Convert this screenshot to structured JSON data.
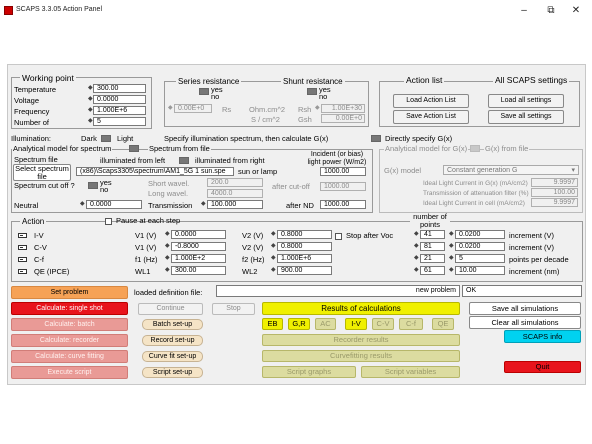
{
  "window": {
    "title": "SCAPS 3.3.05 Action Panel",
    "min": "–",
    "max": "⧉",
    "close": "✕"
  },
  "working_point": {
    "heading": "Working point",
    "rows": [
      {
        "label": "Temperature",
        "value": "300.00"
      },
      {
        "label": "Voltage",
        "value": "0.0000"
      },
      {
        "label": "Frequency",
        "value": "1.000E+6"
      },
      {
        "label": "Number of",
        "value": "5"
      }
    ]
  },
  "series_resistance": {
    "heading": "Series resistance",
    "yes": "yes",
    "no": "no",
    "value": "0.00E+0",
    "rs_label": "Rs",
    "unit1": "Ohm.cm^2",
    "unit2": "S / cm^2"
  },
  "shunt_resistance": {
    "heading": "Shunt resistance",
    "yes": "yes",
    "no": "no",
    "rsh_label": "Rsh",
    "rsh_value": "1.00E+30",
    "gsh_label": "Gsh",
    "gsh_value": "0.00E+0"
  },
  "action_list": {
    "heading": "Action list",
    "load": "Load Action List",
    "save": "Save Action List"
  },
  "all_settings": {
    "heading": "All SCAPS settings",
    "load": "Load all settings",
    "save": "Save all settings"
  },
  "illumination": {
    "label": "Illumination:",
    "dark": "Dark",
    "light": "Light",
    "spec_text": "Specify illumination spectrum, then calculate G(x)",
    "direct_text": "Directly specify G(x)"
  },
  "spectrum": {
    "analytical_label": "Analytical model for spectrum",
    "from_file_label": "Spectrum from file",
    "file_heading": "Spectrum file",
    "select_button": "Select spectrum file",
    "illum_left": "illuminated from left",
    "illum_right": "illuminated from right",
    "incident_label": "Incident (or bias) light power (W/m2)",
    "file_path": "(x86)\\Scaps3305\\spectrum\\AM1_5G 1 sun.spe",
    "sun_or_lamp_label": "sun or lamp",
    "sun_or_lamp_value": "1000.00",
    "cutoff_label": "Spectrum cut off ?",
    "cutoff_yes": "yes",
    "cutoff_no": "no",
    "short_wavel_label": "Short wavel.",
    "short_wavel_value": "200.0",
    "after_cutoff_label": "after cut-off",
    "after_cutoff_value": "1000.00",
    "long_wavel_label": "Long wavel.",
    "long_wavel_value": "4000.0",
    "neutral_label": "Neutral",
    "neutral_value": "0.0000",
    "transmission_label": "Transmission",
    "transmission_value": "100.000",
    "after_nd_label": "after ND",
    "after_nd_value": "1000.00"
  },
  "generation": {
    "analytical_label": "Analytical model for G(x)",
    "from_file_label": "G(x) from file",
    "model_label": "G(x) model",
    "model_value": "Constant generation G",
    "rows": [
      {
        "label": "Ideal Light Current in G(x) (mA/cm2)",
        "value": "9.9997"
      },
      {
        "label": "Transmission of attenuation filter (%)",
        "value": "100.00"
      },
      {
        "label": "Ideal Light Current in cell (mA/cm2)",
        "value": "9.9997"
      }
    ]
  },
  "action": {
    "heading": "Action",
    "pause_label": "Pause at each step",
    "points_heading": "number of points",
    "stop_after_voc": "Stop after Voc",
    "rows": [
      {
        "name": "I-V",
        "p1": "V1 (V)",
        "v1": "0.0000",
        "p2": "V2 (V)",
        "v2": "0.8000",
        "n": "41",
        "inc": "0.0200",
        "unit": "increment (V)"
      },
      {
        "name": "C-V",
        "p1": "V1 (V)",
        "v1": "-0.8000",
        "p2": "V2 (V)",
        "v2": "0.8000",
        "n": "81",
        "inc": "0.0200",
        "unit": "increment (V)"
      },
      {
        "name": "C-f",
        "p1": "f1 (Hz)",
        "v1": "1.000E+2",
        "p2": "f2 (Hz)",
        "v2": "1.000E+6",
        "n": "21",
        "inc": "5",
        "unit": "points per decade"
      },
      {
        "name": "QE (IPCE)",
        "p1": "WL1",
        "v1": "300.00",
        "p2": "WL2",
        "v2": "900.00",
        "n": "61",
        "inc": "10.00",
        "unit": "increment (nm)"
      }
    ]
  },
  "bottom": {
    "set_problem": "Set problem",
    "loaded_label": "loaded definition file:",
    "new_problem": "new problem",
    "ok": "OK",
    "calc_single": "Calculate: single shot",
    "continue": "Continue",
    "stop": "Stop",
    "results_heading": "Results of calculations",
    "save_all_sims": "Save all simulations",
    "clear_all_sims": "Clear all simulations",
    "calc_batch": "Calculate: batch",
    "batch_setup": "Batch set-up",
    "result_tabs": [
      "EB",
      "G,R",
      "AC",
      "I-V",
      "C-V",
      "C-f",
      "QE"
    ],
    "scaps_info": "SCAPS info",
    "calc_recorder": "Calculate: recorder",
    "record_setup": "Record set-up",
    "recorder_results": "Recorder results",
    "calc_curvefit": "Calculate: curve fitting",
    "curvefit_setup": "Curve fit set-up",
    "curvefit_results": "Curvefitting results",
    "execute_script": "Execute script",
    "script_setup": "Script set-up",
    "script_graphs": "Script graphs",
    "script_variables": "Script variables",
    "quit": "Quit"
  },
  "colors": {
    "orange": "#f6a256",
    "red": "#e8141c",
    "pink": "#e99a96",
    "olive": "#d2d27c",
    "yellow": "#f0f000",
    "cyan": "#00d2f0",
    "beige": "#f5e4c6"
  }
}
